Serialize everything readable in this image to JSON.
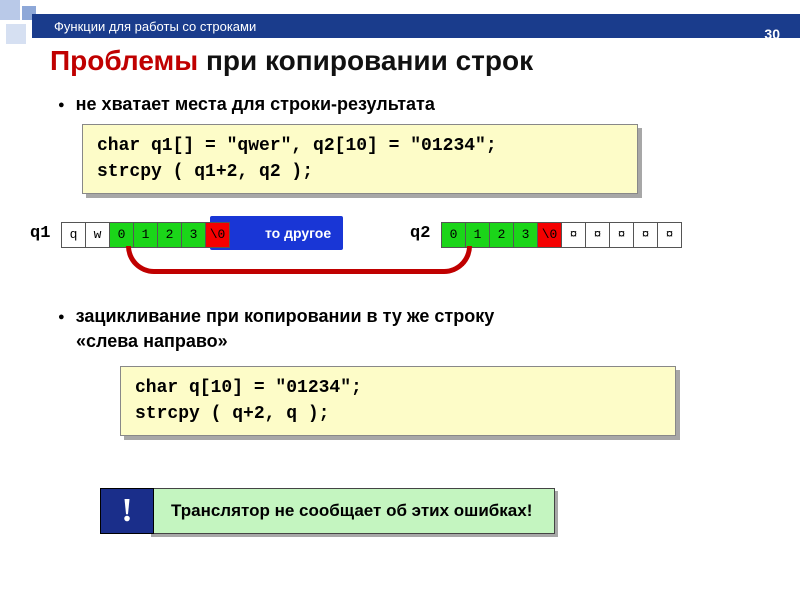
{
  "header": {
    "breadcrumb": "Функции для работы со строками",
    "pagenum": "30"
  },
  "title": {
    "red": "Проблемы",
    "rest": " при копировании строк"
  },
  "bullets": {
    "b1": "не хватает места для строки-результата",
    "b2a": "зацикливание при копировании в ту же строку",
    "b2b": "«слева направо»"
  },
  "code1": {
    "l1": "char q1[] = \"qwer\", q2[10] = \"01234\";",
    "l2": "strcpy ( q1+2, q2 );"
  },
  "code2": {
    "l1": "char q[10] = \"01234\";",
    "l2": "strcpy ( q+2, q );"
  },
  "q1": {
    "label": "q1",
    "cells": [
      "q",
      "w",
      "0",
      "1",
      "2",
      "3",
      "\\0"
    ],
    "blue_text": "то другое"
  },
  "q2": {
    "label": "q2",
    "cells": [
      "0",
      "1",
      "2",
      "3",
      "\\0",
      "¤",
      "¤",
      "¤",
      "¤",
      "¤"
    ]
  },
  "warn": {
    "badge": "!",
    "text": "Транслятор не сообщает об этих ошибках!"
  }
}
